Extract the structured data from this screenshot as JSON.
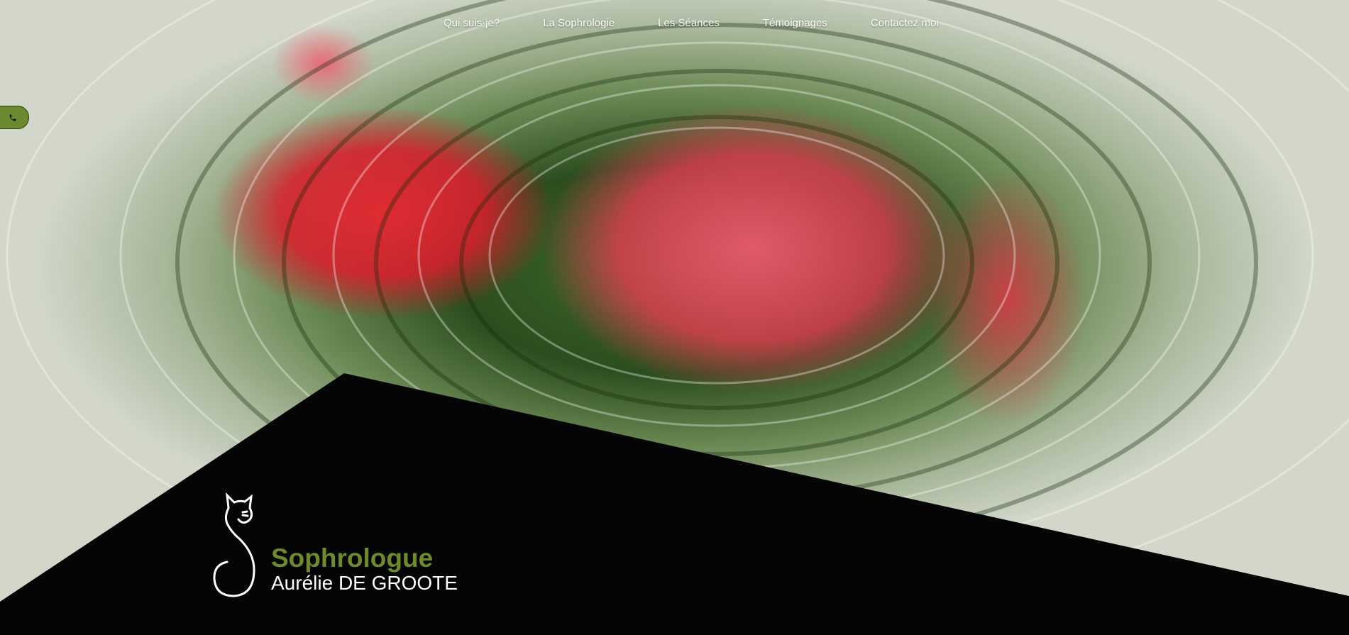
{
  "nav": {
    "items": [
      "Qui suis-je?",
      "La Sophrologie",
      "Les Séances",
      "Témoignages",
      "Contactez moi"
    ]
  },
  "contact": {
    "icon": "phone-icon"
  },
  "brand": {
    "logo_icon": "cat-s-logo-icon",
    "title": "Sophrologue",
    "name": "Aurélie DE GROOTE"
  },
  "colors": {
    "accent": "#6d8a2c",
    "dark_band": "#050505",
    "text": "#ffffff"
  }
}
